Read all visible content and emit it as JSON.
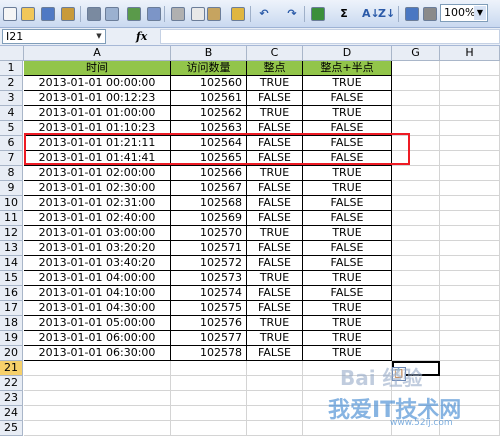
{
  "toolbar": {
    "zoom": "100%",
    "icons": [
      "new-icon",
      "open-icon",
      "save-icon",
      "permission-icon",
      "print-icon",
      "print-preview-icon",
      "spelling-icon",
      "research-icon",
      "cut-icon",
      "copy-icon",
      "paste-icon",
      "format-painter-icon",
      "undo-icon",
      "redo-icon",
      "hyperlink-icon",
      "autosum-icon",
      "sort-ascending-icon",
      "sort-descending-icon",
      "chart-wizard-icon",
      "drawing-icon"
    ]
  },
  "formula_bar": {
    "name_box": "I21",
    "fx_label": "fx",
    "formula": ""
  },
  "sheet": {
    "columns": [
      "A",
      "B",
      "C",
      "D",
      "G",
      "H"
    ],
    "row_numbers": [
      "1",
      "2",
      "3",
      "4",
      "5",
      "6",
      "7",
      "8",
      "9",
      "10",
      "11",
      "12",
      "13",
      "14",
      "15",
      "16",
      "17",
      "18",
      "19",
      "20",
      "21",
      "22",
      "23",
      "24",
      "25"
    ],
    "headers": [
      "时间",
      "访问数量",
      "整点",
      "整点+半点"
    ],
    "rows": [
      [
        "2013-01-01  00:00:00",
        "102560",
        "TRUE",
        "TRUE"
      ],
      [
        "2013-01-01  00:12:23",
        "102561",
        "FALSE",
        "FALSE"
      ],
      [
        "2013-01-01  01:00:00",
        "102562",
        "TRUE",
        "TRUE"
      ],
      [
        "2013-01-01  01:10:23",
        "102563",
        "FALSE",
        "FALSE"
      ],
      [
        "2013-01-01  01:21:11",
        "102564",
        "FALSE",
        "FALSE"
      ],
      [
        "2013-01-01  01:41:41",
        "102565",
        "FALSE",
        "FALSE"
      ],
      [
        "2013-01-01  02:00:00",
        "102566",
        "TRUE",
        "TRUE"
      ],
      [
        "2013-01-01  02:30:00",
        "102567",
        "FALSE",
        "TRUE"
      ],
      [
        "2013-01-01  02:31:00",
        "102568",
        "FALSE",
        "FALSE"
      ],
      [
        "2013-01-01  02:40:00",
        "102569",
        "FALSE",
        "FALSE"
      ],
      [
        "2013-01-01  03:00:00",
        "102570",
        "TRUE",
        "TRUE"
      ],
      [
        "2013-01-01  03:20:20",
        "102571",
        "FALSE",
        "FALSE"
      ],
      [
        "2013-01-01  03:40:20",
        "102572",
        "FALSE",
        "FALSE"
      ],
      [
        "2013-01-01  04:00:00",
        "102573",
        "TRUE",
        "TRUE"
      ],
      [
        "2013-01-01  04:10:00",
        "102574",
        "FALSE",
        "FALSE"
      ],
      [
        "2013-01-01  04:30:00",
        "102575",
        "FALSE",
        "TRUE"
      ],
      [
        "2013-01-01  05:00:00",
        "102576",
        "TRUE",
        "TRUE"
      ],
      [
        "2013-01-01  06:00:00",
        "102577",
        "TRUE",
        "TRUE"
      ],
      [
        "2013-01-01  06:30:00",
        "102578",
        "FALSE",
        "TRUE"
      ]
    ],
    "header_fill": "#92c54a",
    "highlight_color": "#ee1b24",
    "highlighted_row": "9"
  },
  "watermark": {
    "text_top": "Bai 经验",
    "text_bottom": "我爱IT技术网",
    "url": "www.52ij.com"
  }
}
